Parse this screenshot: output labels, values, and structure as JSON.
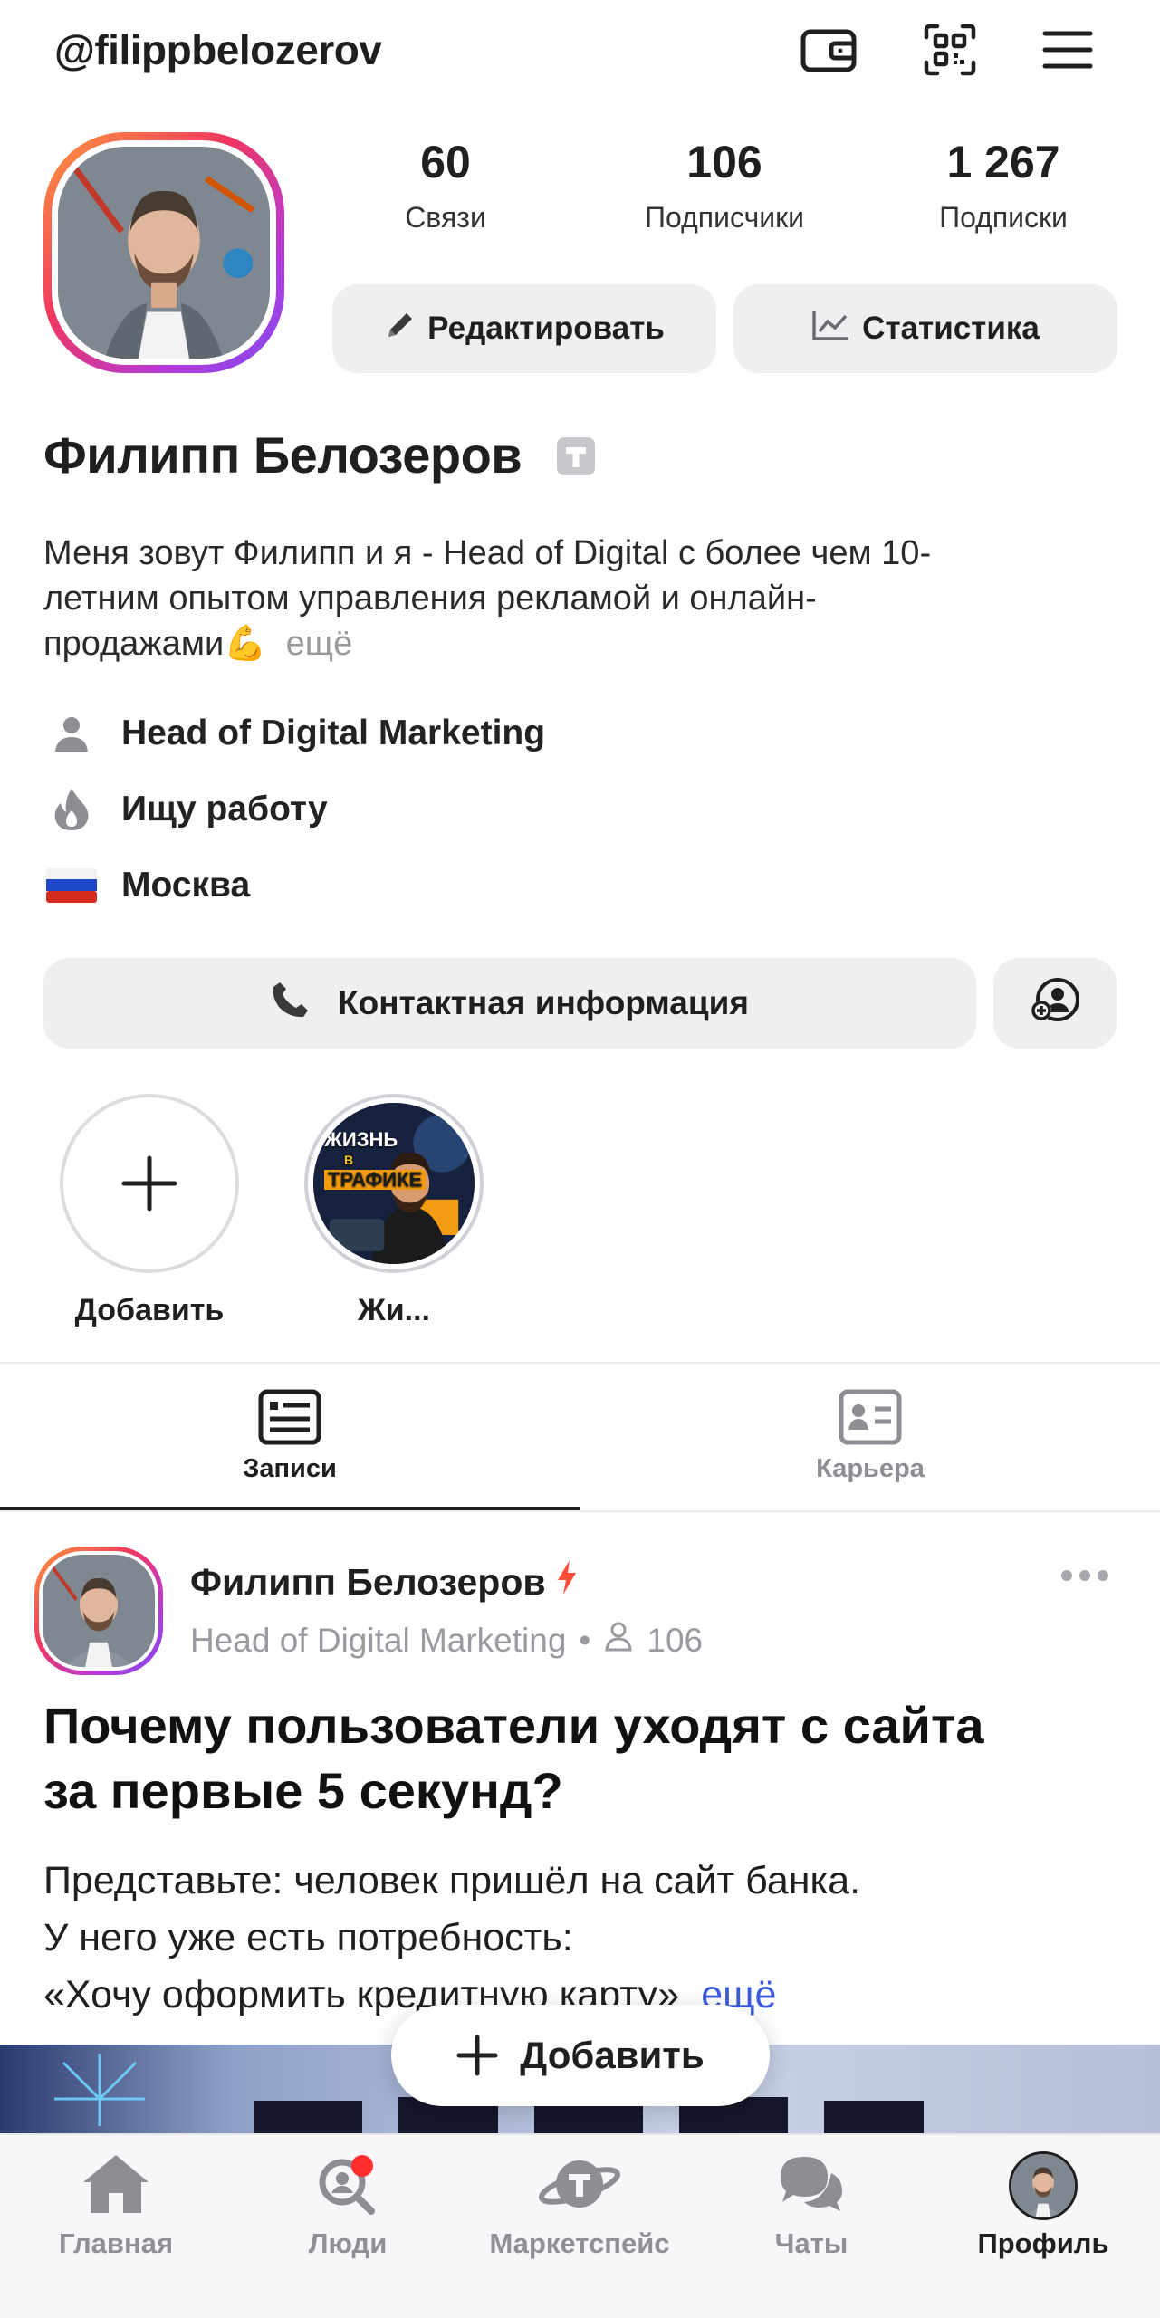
{
  "header": {
    "username": "@filippbelozerov"
  },
  "profile": {
    "stats": [
      {
        "value": "60",
        "label": "Связи"
      },
      {
        "value": "106",
        "label": "Подписчики"
      },
      {
        "value": "1 267",
        "label": "Подписки"
      }
    ],
    "edit_label": "Редактировать",
    "stats_label": "Статистика",
    "name": "Филипп Белозеров",
    "bio_line1": "Меня зовут Филипп и я - Head of Digital с более чем 10-",
    "bio_line2": "летним опытом управления рекламой и онлайн-",
    "bio_line3": "продажами💪",
    "bio_more": "ещё",
    "position": "Head of Digital Marketing",
    "status": "Ищу работу",
    "city": "Москва",
    "contact_label": "Контактная информация"
  },
  "stories": {
    "add_label": "Добавить",
    "items": [
      {
        "label": "Жи...",
        "cover_line1": "ЖИЗНЬ",
        "cover_line2": "В",
        "cover_line3": "ТРАФИКЕ"
      }
    ]
  },
  "tabs": [
    {
      "label": "Записи",
      "active": true
    },
    {
      "label": "Карьера",
      "active": false
    }
  ],
  "post": {
    "author": "Филипп Белозеров",
    "subtitle": "Head of Digital Marketing",
    "separator": "•",
    "followers": "106",
    "title_line1": "Почему пользователи уходят с сайта",
    "title_line2": "за первые 5 секунд?",
    "text_line1": "Представьте: человек пришёл на сайт банка.",
    "text_line2": "У него уже есть потребность:",
    "text_line3": "«Хочу оформить кредитную карту»",
    "text_more": "ещё"
  },
  "fab": {
    "label": "Добавить"
  },
  "bottom_nav": [
    {
      "label": "Главная",
      "icon": "home-icon"
    },
    {
      "label": "Люди",
      "icon": "people-search-icon"
    },
    {
      "label": "Маркетспейс",
      "icon": "planet-icon"
    },
    {
      "label": "Чаты",
      "icon": "chat-icon"
    },
    {
      "label": "Профиль",
      "icon": "profile-avatar"
    }
  ],
  "colors": {
    "accent_blue": "#3b5bdb",
    "tab_active": "#1f1f1f",
    "notification": "#ff2d2d",
    "lightning": "#ff4d3a"
  }
}
